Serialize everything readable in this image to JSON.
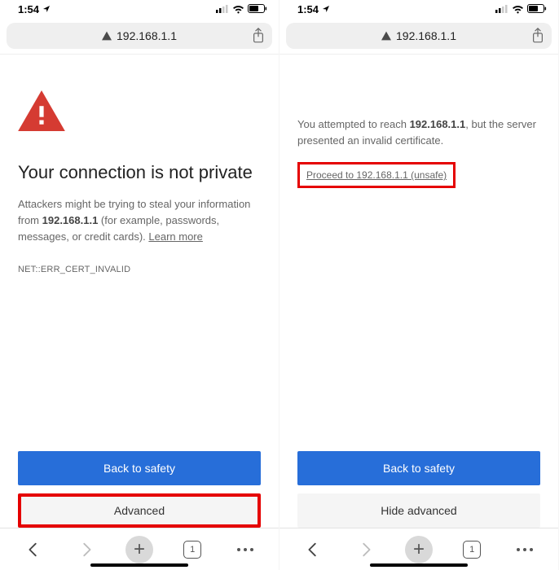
{
  "status": {
    "time": "1:54"
  },
  "url": "192.168.1.1",
  "left": {
    "headline": "Your connection is not private",
    "body_pre": "Attackers might be trying to steal your information from ",
    "body_bold": "192.168.1.1",
    "body_post": " (for example, passwords, messages, or credit cards). ",
    "learn": "Learn more",
    "error": "NET::ERR_CERT_INVALID",
    "primary": "Back to safety",
    "secondary": "Advanced"
  },
  "right": {
    "body_pre": "You attempted to reach ",
    "body_bold": "192.168.1.1",
    "body_post": ", but the server presented an invalid certificate.",
    "proceed": "Proceed to 192.168.1.1 (unsafe)",
    "primary": "Back to safety",
    "secondary": "Hide advanced"
  },
  "nav": {
    "tab_count": "1"
  }
}
